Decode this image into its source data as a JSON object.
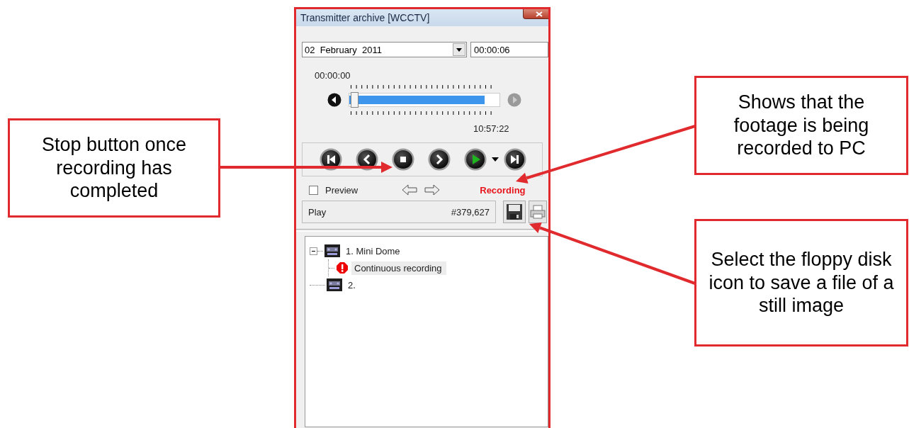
{
  "window": {
    "title": "Transmitter archive [WCCTV]"
  },
  "date_picker": {
    "value": "02  February  2011"
  },
  "time_field": {
    "value": "00:00:06"
  },
  "timeline": {
    "start_time": "00:00:00",
    "end_time": "10:57:22",
    "level": 0.9,
    "back_disabled": false,
    "forward_disabled": true
  },
  "transport_buttons": [
    {
      "kind": "first"
    },
    {
      "kind": "previous"
    },
    {
      "kind": "stop"
    },
    {
      "kind": "next"
    },
    {
      "kind": "play"
    },
    {
      "kind": "dropdown"
    },
    {
      "kind": "last"
    }
  ],
  "preview": {
    "label": "Preview",
    "checked": false
  },
  "recording_status": "Recording",
  "status_field": {
    "mode": "Play",
    "frame": "#379,627"
  },
  "tree": [
    {
      "label": "1. Mini Dome",
      "kind": "camera",
      "expanded": true,
      "selected": false,
      "children": [
        {
          "label": "Continuous recording",
          "kind": "alert",
          "selected": true
        }
      ]
    },
    {
      "label": "2.",
      "kind": "camera",
      "selected": false
    }
  ],
  "callouts": [
    {
      "text": "Stop button once recording has completed"
    },
    {
      "text": "Shows that the footage is being recorded to PC"
    },
    {
      "text": "Select the floppy disk icon to save a file of a still image"
    }
  ]
}
